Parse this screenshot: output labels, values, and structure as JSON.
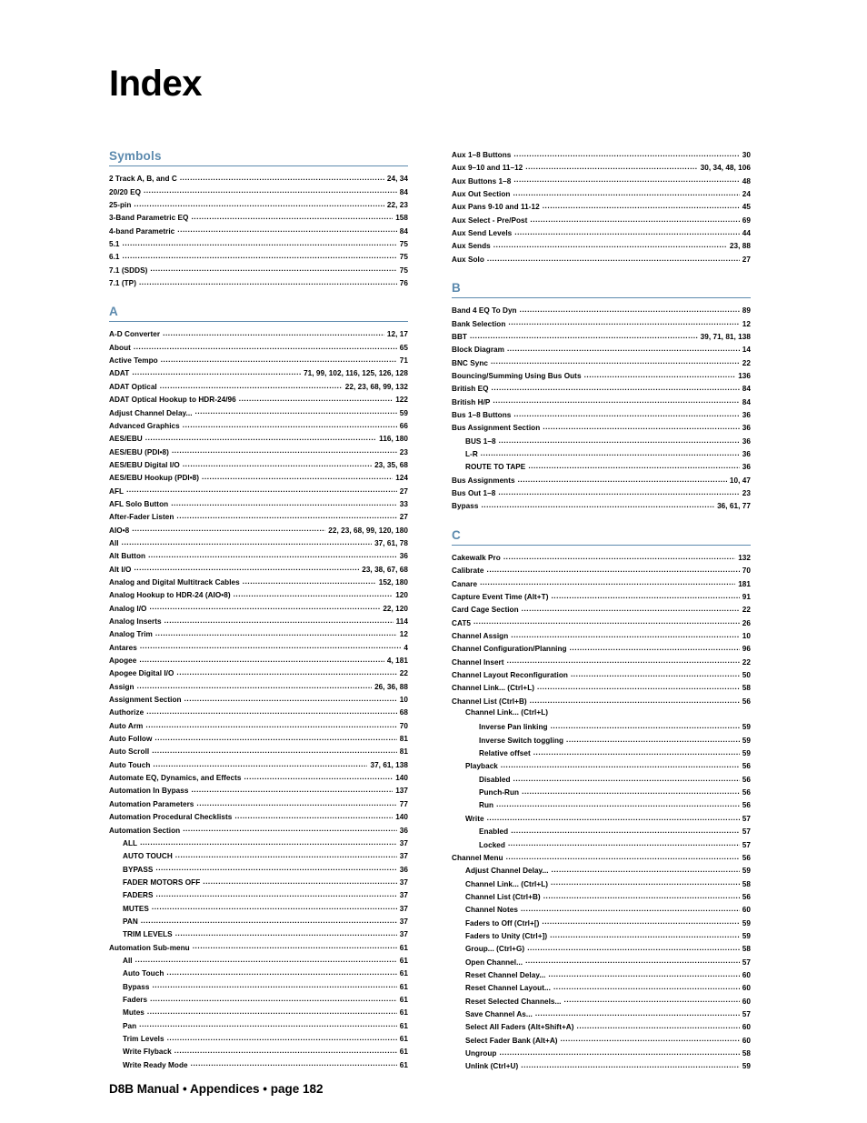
{
  "page": {
    "title": "Index",
    "footer": "D8B Manual • Appendices • page  182"
  },
  "theme": {
    "accent": "#5c8aae",
    "text": "#000000",
    "background": "#ffffff"
  },
  "columns": [
    {
      "name": "left-column",
      "sections": [
        {
          "heading": "Symbols",
          "entries": [
            {
              "term": "2 Track A, B, and C",
              "pages": "24,  34",
              "level": 1
            },
            {
              "term": "20/20 EQ",
              "pages": "84",
              "level": 1
            },
            {
              "term": "25-pin",
              "pages": "22,  23",
              "level": 1
            },
            {
              "term": "3-Band Parametric EQ",
              "pages": "158",
              "level": 1
            },
            {
              "term": "4-band Parametric",
              "pages": "84",
              "level": 1
            },
            {
              "term": "5.1",
              "pages": "75",
              "level": 1
            },
            {
              "term": "6.1",
              "pages": "75",
              "level": 1
            },
            {
              "term": "7.1 (SDDS)",
              "pages": "75",
              "level": 1
            },
            {
              "term": "7.1 (TP)",
              "pages": "76",
              "level": 1
            }
          ]
        },
        {
          "heading": "A",
          "entries": [
            {
              "term": "A-D Converter",
              "pages": "12,  17",
              "level": 1
            },
            {
              "term": "About",
              "pages": "65",
              "level": 1
            },
            {
              "term": "Active Tempo",
              "pages": "71",
              "level": 1
            },
            {
              "term": "ADAT",
              "pages": "71,  99,  102,  116,  125,  126,  128",
              "level": 1
            },
            {
              "term": "ADAT Optical",
              "pages": "22,  23,  68,  99,  132",
              "level": 1
            },
            {
              "term": "ADAT Optical Hookup to HDR-24/96",
              "pages": "122",
              "level": 1
            },
            {
              "term": "Adjust Channel Delay...",
              "pages": "59",
              "level": 1
            },
            {
              "term": "Advanced Graphics",
              "pages": "66",
              "level": 1
            },
            {
              "term": "AES/EBU",
              "pages": "116,  180",
              "level": 1
            },
            {
              "term": "AES/EBU (PDI•8)",
              "pages": "23",
              "level": 1
            },
            {
              "term": "AES/EBU Digital I/O",
              "pages": "23,  35,  68",
              "level": 1
            },
            {
              "term": "AES/EBU Hookup (PDI•8)",
              "pages": "124",
              "level": 1
            },
            {
              "term": "AFL",
              "pages": "27",
              "level": 1
            },
            {
              "term": "AFL Solo Button",
              "pages": "33",
              "level": 1
            },
            {
              "term": "After-Fader Listen",
              "pages": "27",
              "level": 1
            },
            {
              "term": "AIO•8",
              "pages": "22,  23,  68,  99,  120,  180",
              "level": 1
            },
            {
              "term": "All",
              "pages": "37,  61,  78",
              "level": 1
            },
            {
              "term": "Alt Button",
              "pages": "36",
              "level": 1
            },
            {
              "term": "Alt I/O",
              "pages": "23,  38,  67,  68",
              "level": 1
            },
            {
              "term": "Analog and Digital Multitrack Cables",
              "pages": "152,  180",
              "level": 1
            },
            {
              "term": "Analog Hookup to HDR-24 (AIO•8)",
              "pages": "120",
              "level": 1
            },
            {
              "term": "Analog I/O",
              "pages": "22,  120",
              "level": 1
            },
            {
              "term": "Analog Inserts",
              "pages": "114",
              "level": 1
            },
            {
              "term": "Analog Trim",
              "pages": "12",
              "level": 1
            },
            {
              "term": "Antares",
              "pages": "4",
              "level": 1
            },
            {
              "term": "Apogee",
              "pages": "4,  181",
              "level": 1
            },
            {
              "term": "Apogee Digital I/O",
              "pages": "22",
              "level": 1
            },
            {
              "term": "Assign",
              "pages": "26,  36,  88",
              "level": 1
            },
            {
              "term": "Assignment Section",
              "pages": "10",
              "level": 1
            },
            {
              "term": "Authorize",
              "pages": "68",
              "level": 1
            },
            {
              "term": "Auto Arm",
              "pages": "70",
              "level": 1
            },
            {
              "term": "Auto Follow",
              "pages": "81",
              "level": 1
            },
            {
              "term": "Auto Scroll",
              "pages": "81",
              "level": 1
            },
            {
              "term": "Auto Touch",
              "pages": "37,  61,  138",
              "level": 1
            },
            {
              "term": "Automate EQ, Dynamics, and Effects",
              "pages": "140",
              "level": 1
            },
            {
              "term": "Automation In Bypass",
              "pages": "137",
              "level": 1
            },
            {
              "term": "Automation Parameters",
              "pages": "77",
              "level": 1
            },
            {
              "term": "Automation Procedural Checklists",
              "pages": "140",
              "level": 1
            },
            {
              "term": "Automation Section",
              "pages": "36",
              "level": 1
            },
            {
              "term": "ALL",
              "pages": "37",
              "level": 2
            },
            {
              "term": "AUTO TOUCH",
              "pages": "37",
              "level": 2
            },
            {
              "term": "BYPASS",
              "pages": "36",
              "level": 2
            },
            {
              "term": "FADER MOTORS OFF",
              "pages": "37",
              "level": 2
            },
            {
              "term": "FADERS",
              "pages": "37",
              "level": 2
            },
            {
              "term": "MUTES",
              "pages": "37",
              "level": 2
            },
            {
              "term": "PAN",
              "pages": "37",
              "level": 2
            },
            {
              "term": "TRIM LEVELS",
              "pages": "37",
              "level": 2
            },
            {
              "term": "Automation Sub-menu",
              "pages": "61",
              "level": 1
            },
            {
              "term": "All",
              "pages": "61",
              "level": 2
            },
            {
              "term": "Auto Touch",
              "pages": "61",
              "level": 2
            },
            {
              "term": "Bypass",
              "pages": "61",
              "level": 2
            },
            {
              "term": "Faders",
              "pages": "61",
              "level": 2
            },
            {
              "term": "Mutes",
              "pages": "61",
              "level": 2
            },
            {
              "term": "Pan",
              "pages": "61",
              "level": 2
            },
            {
              "term": "Trim Levels",
              "pages": "61",
              "level": 2
            },
            {
              "term": "Write Flyback",
              "pages": "61",
              "level": 2
            },
            {
              "term": "Write Ready Mode",
              "pages": "61",
              "level": 2
            }
          ]
        }
      ]
    },
    {
      "name": "right-column",
      "sections": [
        {
          "heading": null,
          "entries": [
            {
              "term": "Aux 1–8 Buttons",
              "pages": "30",
              "level": 1
            },
            {
              "term": "Aux 9–10 and 11–12",
              "pages": "30,  34,  48,  106",
              "level": 1
            },
            {
              "term": "Aux Buttons 1–8",
              "pages": "48",
              "level": 1
            },
            {
              "term": "Aux Out Section",
              "pages": "24",
              "level": 1
            },
            {
              "term": "Aux Pans 9-10 and 11-12",
              "pages": "45",
              "level": 1
            },
            {
              "term": "Aux Select - Pre/Post",
              "pages": "69",
              "level": 1
            },
            {
              "term": "Aux Send Levels",
              "pages": "44",
              "level": 1
            },
            {
              "term": "Aux Sends",
              "pages": "23,  88",
              "level": 1
            },
            {
              "term": "Aux Solo",
              "pages": "27",
              "level": 1
            }
          ]
        },
        {
          "heading": "B",
          "entries": [
            {
              "term": "Band 4 EQ To Dyn",
              "pages": "89",
              "level": 1
            },
            {
              "term": "Bank Selection",
              "pages": "12",
              "level": 1
            },
            {
              "term": "BBT",
              "pages": "39,  71,  81,  138",
              "level": 1
            },
            {
              "term": "Block Diagram",
              "pages": "14",
              "level": 1
            },
            {
              "term": "BNC Sync",
              "pages": "22",
              "level": 1
            },
            {
              "term": "Bouncing/Summing Using Bus Outs",
              "pages": "136",
              "level": 1
            },
            {
              "term": "British EQ",
              "pages": "84",
              "level": 1
            },
            {
              "term": "British H/P",
              "pages": "84",
              "level": 1
            },
            {
              "term": "Bus 1–8 Buttons",
              "pages": "36",
              "level": 1
            },
            {
              "term": "Bus Assignment Section",
              "pages": "36",
              "level": 1
            },
            {
              "term": "BUS 1–8",
              "pages": "36",
              "level": 2
            },
            {
              "term": "L-R",
              "pages": "36",
              "level": 2
            },
            {
              "term": "ROUTE TO TAPE",
              "pages": "36",
              "level": 2
            },
            {
              "term": "Bus Assignments",
              "pages": "10,  47",
              "level": 1
            },
            {
              "term": "Bus Out 1–8",
              "pages": "23",
              "level": 1
            },
            {
              "term": "Bypass",
              "pages": "36,  61,  77",
              "level": 1
            }
          ]
        },
        {
          "heading": "C",
          "entries": [
            {
              "term": "Cakewalk Pro",
              "pages": "132",
              "level": 1
            },
            {
              "term": "Calibrate",
              "pages": "70",
              "level": 1
            },
            {
              "term": "Canare",
              "pages": "181",
              "level": 1
            },
            {
              "term": "Capture Event Time (Alt+T)",
              "pages": "91",
              "level": 1
            },
            {
              "term": "Card Cage Section",
              "pages": "22",
              "level": 1
            },
            {
              "term": "CAT5",
              "pages": "26",
              "level": 1
            },
            {
              "term": "Channel Assign",
              "pages": "10",
              "level": 1
            },
            {
              "term": "Channel Configuration/Planning",
              "pages": "96",
              "level": 1
            },
            {
              "term": "Channel Insert",
              "pages": "22",
              "level": 1
            },
            {
              "term": "Channel Layout Reconfiguration",
              "pages": "50",
              "level": 1
            },
            {
              "term": "Channel Link... (Ctrl+L)",
              "pages": "58",
              "level": 1
            },
            {
              "term": "Channel List (Ctrl+B)",
              "pages": "56",
              "level": 1
            },
            {
              "term": "Channel Link... (Ctrl+L)",
              "pages": "",
              "level": 2
            },
            {
              "term": "Inverse Pan linking",
              "pages": "59",
              "level": 3
            },
            {
              "term": "Inverse Switch toggling",
              "pages": "59",
              "level": 3
            },
            {
              "term": "Relative offset",
              "pages": "59",
              "level": 3
            },
            {
              "term": "Playback",
              "pages": "56",
              "level": 2
            },
            {
              "term": "Disabled",
              "pages": "56",
              "level": 3
            },
            {
              "term": "Punch-Run",
              "pages": "56",
              "level": 3
            },
            {
              "term": "Run",
              "pages": "56",
              "level": 3
            },
            {
              "term": "Write",
              "pages": "57",
              "level": 2
            },
            {
              "term": "Enabled",
              "pages": "57",
              "level": 3
            },
            {
              "term": "Locked",
              "pages": "57",
              "level": 3
            },
            {
              "term": "Channel Menu",
              "pages": "56",
              "level": 1
            },
            {
              "term": "Adjust Channel Delay...",
              "pages": "59",
              "level": 2
            },
            {
              "term": "Channel Link... (Ctrl+L)",
              "pages": "58",
              "level": 2
            },
            {
              "term": "Channel List (Ctrl+B)",
              "pages": "56",
              "level": 2
            },
            {
              "term": "Channel Notes",
              "pages": "60",
              "level": 2
            },
            {
              "term": "Faders to Off (Ctrl+[)",
              "pages": "59",
              "level": 2
            },
            {
              "term": "Faders to Unity (Ctrl+])",
              "pages": "59",
              "level": 2
            },
            {
              "term": "Group... (Ctrl+G)",
              "pages": "58",
              "level": 2
            },
            {
              "term": "Open Channel...",
              "pages": "57",
              "level": 2
            },
            {
              "term": "Reset Channel Delay...",
              "pages": "60",
              "level": 2
            },
            {
              "term": "Reset Channel Layout...",
              "pages": "60",
              "level": 2
            },
            {
              "term": "Reset Selected Channels...",
              "pages": "60",
              "level": 2
            },
            {
              "term": "Save Channel As...",
              "pages": "57",
              "level": 2
            },
            {
              "term": "Select All Faders (Alt+Shift+A)",
              "pages": "60",
              "level": 2
            },
            {
              "term": "Select Fader Bank (Alt+A)",
              "pages": "60",
              "level": 2
            },
            {
              "term": "Ungroup",
              "pages": "58",
              "level": 2
            },
            {
              "term": "Unlink (Ctrl+U)",
              "pages": "59",
              "level": 2
            }
          ]
        }
      ]
    }
  ]
}
